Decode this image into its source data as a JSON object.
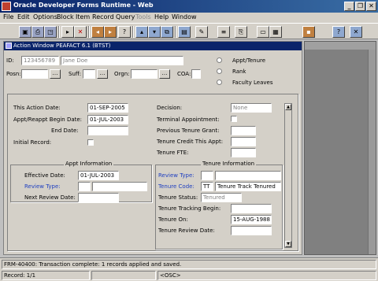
{
  "window": {
    "title": "Oracle Developer Forms Runtime - Web",
    "minimize_glyph": "_",
    "restore_glyph": "❐",
    "close_glyph": "✕"
  },
  "menu": [
    "File",
    "Edit",
    "Options",
    "Block",
    "Item",
    "Record",
    "Query",
    "Tools",
    "Help",
    "Window"
  ],
  "toolbar_icons": [
    "save-icon",
    "print-icon",
    "exit-icon",
    "insert-record-icon",
    "delete-record-icon",
    "previous-block-icon",
    "next-block-icon",
    "previous-record-icon",
    "next-record-icon",
    "enter-query-icon",
    "execute-query-icon",
    "cancel-query-icon",
    "edit-icon",
    "list-values-icon",
    "help-icon",
    "exit-form-icon"
  ],
  "inner_window": {
    "title": "Action Window  PEAFACT  6.1  (BTST)"
  },
  "header": {
    "id_label": "ID:",
    "id_value": "123456789",
    "name_value": "Jane Doe",
    "posn_label": "Posn:",
    "suff_label": "Suff:",
    "orgn_label": "Orgn:",
    "coa_label": "COA:",
    "radios": [
      "Appt/Tenure",
      "Rank",
      "Faculty Leaves"
    ]
  },
  "left_form": {
    "this_action_date_label": "This Action Date:",
    "this_action_date": "01-SEP-2005",
    "appt_begin_label": "Appt/Reappt Begin Date:",
    "appt_begin": "01-JUL-2003",
    "end_date_label": "End Date:",
    "initial_record_label": "Initial Record:"
  },
  "right_form": {
    "decision_label": "Decision:",
    "decision_value": "None",
    "terminal_label": "Terminal Appointment:",
    "prev_grant_label": "Previous Tenure Grant:",
    "credit_label": "Tenure Credit This Appt:",
    "fte_label": "Tenure FTE:"
  },
  "appt_info": {
    "header": "Appt Information",
    "effective_date_label": "Effective Date:",
    "effective_date": "01-JUL-2003",
    "review_type_label": "Review Type:",
    "next_review_label": "Next Review Date:"
  },
  "tenure_info": {
    "header": "Tenure Information",
    "review_type_label": "Review Type:",
    "code_label": "Tenure Code:",
    "code_value": "TT",
    "code_desc": "Tenure Track Tenured",
    "status_label": "Tenure Status:",
    "status_value": "Tenured",
    "tracking_label": "Tenure Tracking Begin:",
    "on_label": "Tenure On:",
    "on_value": "15-AUG-1988",
    "review_date_label": "Tenure Review Date:"
  },
  "status": {
    "message": "FRM-40400: Transaction complete: 1 records applied and saved.",
    "record": "Record: 1/1",
    "osc": "<OSC>"
  }
}
